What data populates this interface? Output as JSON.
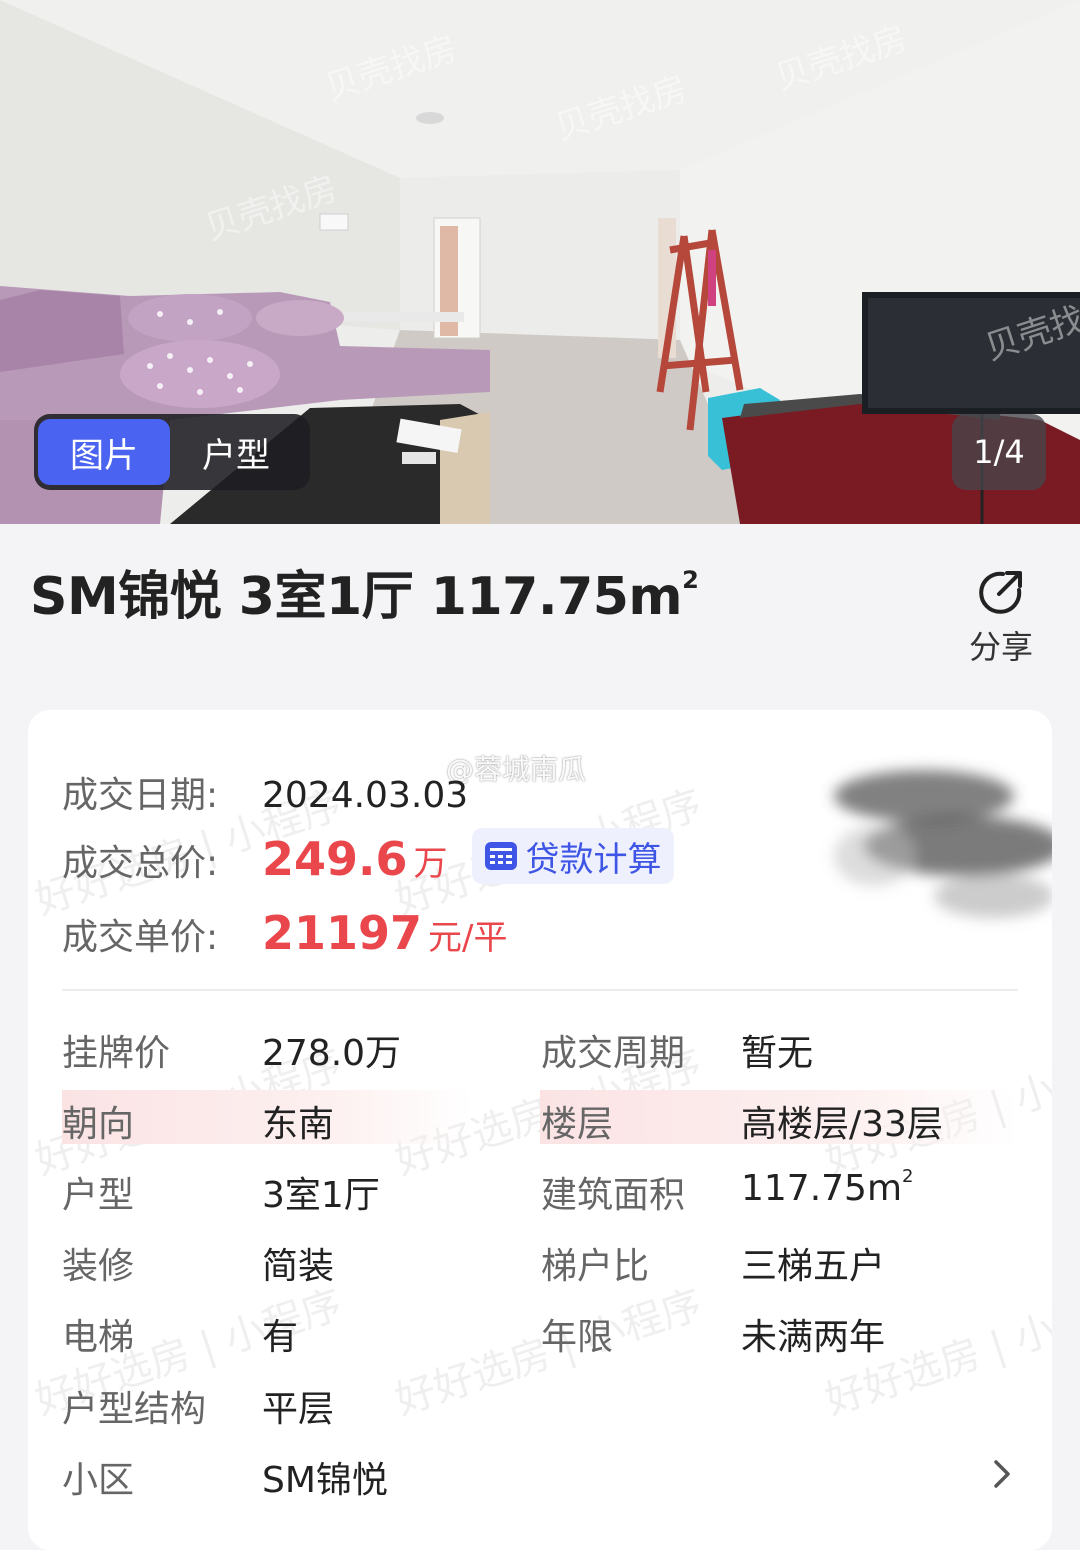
{
  "gallery": {
    "tabs": [
      {
        "label": "图片",
        "active": true
      },
      {
        "label": "户型",
        "active": false
      }
    ],
    "counter": "1/4",
    "accent": "#4a63f0"
  },
  "listing": {
    "title": "SM锦悦 3室1厅 117.75m",
    "title_sup": "2",
    "share_label": "分享"
  },
  "deal": {
    "date_label": "成交日期:",
    "date_value": "2024.03.03",
    "total_label": "成交总价:",
    "total_value": "249.6",
    "total_unit": "万",
    "loan_button": "贷款计算",
    "unit_label": "成交单价:",
    "unit_value": "21197",
    "unit_unit": "元/平",
    "price_color": "#e9474b"
  },
  "specs": {
    "list_price_label": "挂牌价",
    "list_price_value": "278.0万",
    "cycle_label": "成交周期",
    "cycle_value": "暂无",
    "orientation_label": "朝向",
    "orientation_value": "东南",
    "floor_label": "楼层",
    "floor_value": "高楼层/33层",
    "layout_label": "户型",
    "layout_value": "3室1厅",
    "area_label": "建筑面积",
    "area_value": "117.75m",
    "area_sup": "2",
    "decoration_label": "装修",
    "decoration_value": "简装",
    "elevator_ratio_label": "梯户比",
    "elevator_ratio_value": "三梯五户",
    "elevator_label": "电梯",
    "elevator_value": "有",
    "years_label": "年限",
    "years_value": "未满两年",
    "structure_label": "户型结构",
    "structure_value": "平层",
    "community_label": "小区",
    "community_value": "SM锦悦"
  },
  "watermarks": {
    "weibo": "@蓉城南瓜",
    "mini_program": "好好选房 | 小程序",
    "photo": "贝壳找房"
  },
  "icons": {
    "share": "share-icon",
    "calculator": "calculator-icon",
    "chevron": "chevron-right-icon"
  }
}
